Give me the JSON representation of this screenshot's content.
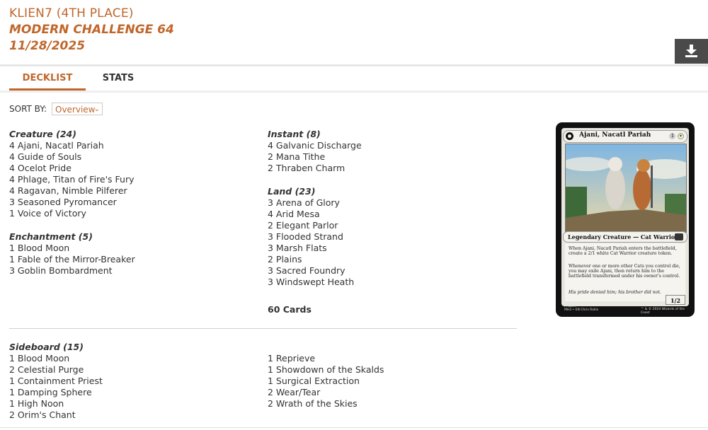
{
  "header": {
    "player": "KLIEN7 (4TH PLACE)",
    "event": "MODERN CHALLENGE 64",
    "date": "11/28/2025"
  },
  "tabs": [
    {
      "label": "DECKLIST",
      "active": true
    },
    {
      "label": "STATS",
      "active": false
    }
  ],
  "sort": {
    "label": "SORT BY:",
    "selected": "Overview"
  },
  "main_left": [
    {
      "heading": "Creature (24)",
      "cards": [
        "4 Ajani, Nacatl Pariah",
        "4 Guide of Souls",
        "4 Ocelot Pride",
        "4 Phlage, Titan of Fire's Fury",
        "4 Ragavan, Nimble Pilferer",
        "3 Seasoned Pyromancer",
        "1 Voice of Victory"
      ]
    },
    {
      "heading": "Enchantment (5)",
      "cards": [
        "1 Blood Moon",
        "1 Fable of the Mirror-Breaker",
        "3 Goblin Bombardment"
      ]
    }
  ],
  "main_right": [
    {
      "heading": "Instant (8)",
      "cards": [
        "4 Galvanic Discharge",
        "2 Mana Tithe",
        "2 Thraben Charm"
      ]
    },
    {
      "heading": "Land (23)",
      "cards": [
        "3 Arena of Glory",
        "4 Arid Mesa",
        "2 Elegant Parlor",
        "3 Flooded Strand",
        "3 Marsh Flats",
        "2 Plains",
        "3 Sacred Foundry",
        "3 Windswept Heath"
      ]
    }
  ],
  "total": "60 Cards",
  "sideboard": {
    "heading": "Sideboard (15)",
    "left": [
      "1 Blood Moon",
      "2 Celestial Purge",
      "1 Containment Priest",
      "1 Damping Sphere",
      "1 High Noon",
      "2 Orim's Chant"
    ],
    "right": [
      "1 Reprieve",
      "1 Showdown of the Skalds",
      "1 Surgical Extraction",
      "2 Wear/Tear",
      "2 Wrath of the Skies"
    ]
  },
  "card_preview": {
    "name": "Ajani, Nacatl Pariah",
    "cost": "1",
    "type_line": "Legendary Creature — Cat Warrior",
    "rules1": "When Ajani, Nacatl Pariah enters the battlefield, create a 2/1 white Cat Warrior creature token.",
    "rules2": "Whenever one or more other Cats you control die, you may exile Ajani, then return him to the battlefield transformed under his owner's control.",
    "flavor": "His pride denied him; his brother did not.",
    "pt": "1/2",
    "footer_left": "M 0237\nMH3 • EN Chris Rallis",
    "footer_right": "™ & © 2024 Wizards of the Coast"
  },
  "icons": {
    "download": "download-icon"
  },
  "colors": {
    "accent": "#c0662a",
    "button": "#4a4a4a"
  }
}
